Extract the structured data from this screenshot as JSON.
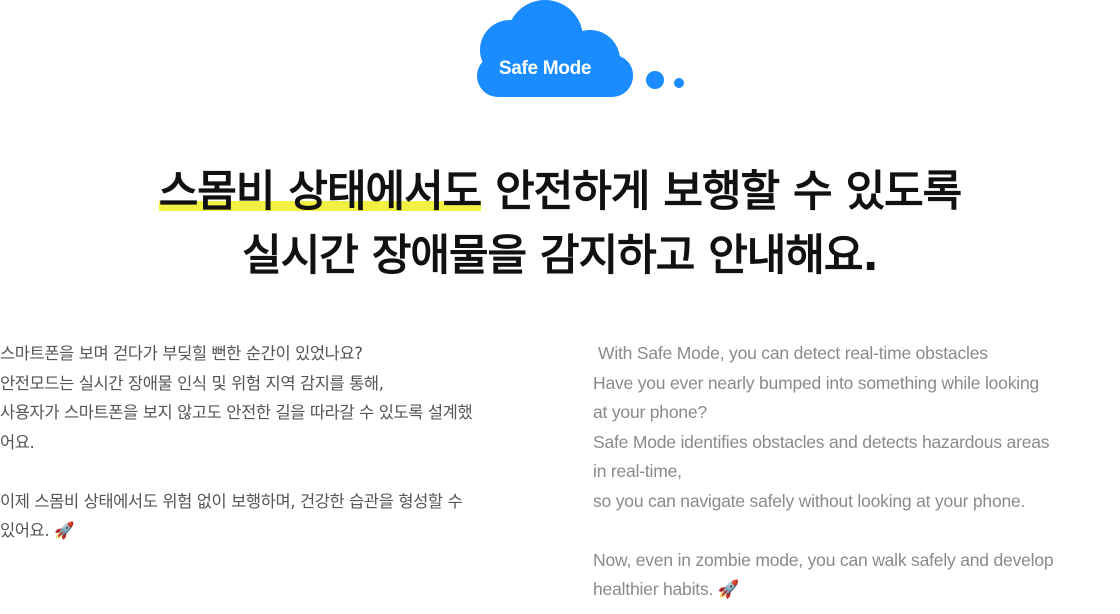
{
  "badge": {
    "label": "Safe Mode",
    "color": "#1a8cff"
  },
  "headline": {
    "line1_highlight": "스몸비 상태에서도",
    "line1_rest": " 안전하게 보행할 수 있도록",
    "line2": "실시간 장애물을 감지하고 안내해요.",
    "highlight_color": "#f2f043"
  },
  "korean": {
    "p1": [
      "스마트폰을 보며 걷다가 부딪힐 뻔한 순간이 있었나요?",
      "안전모드는 실시간 장애물 인식 및 위험 지역 감지를 통해,",
      "사용자가 스마트폰을 보지 않고도 안전한 길을 따라갈 수 있도록 설계했",
      "어요."
    ],
    "p2": [
      "이제 스몸비 상태에서도 위험 없이 보행하며, 건강한 습관을 형성할 수",
      "있어요. 🚀"
    ]
  },
  "english": {
    "p1": [
      "With Safe Mode, you can detect real-time obstacles",
      "Have you ever nearly bumped into something while looking",
      "at your phone?",
      "Safe Mode identifies obstacles and detects hazardous areas",
      "in real-time,",
      "so you can navigate safely without looking at your phone."
    ],
    "p2": [
      "Now, even in zombie mode, you can walk safely and develop",
      "healthier habits. 🚀"
    ]
  }
}
